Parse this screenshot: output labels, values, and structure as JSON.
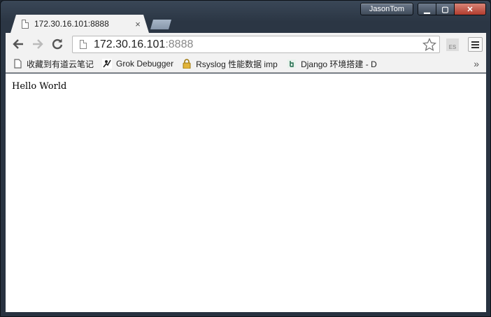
{
  "window": {
    "profile_name": "JasonTom",
    "controls": {
      "minimize": "▁",
      "maximize": "▢",
      "close": "✕"
    }
  },
  "tab": {
    "title": "172.30.16.101:8888",
    "close": "×"
  },
  "omnibox": {
    "host": "172.30.16.101",
    "port": ":8888"
  },
  "extension": {
    "label": "ES"
  },
  "bookmarks": {
    "items": [
      {
        "label": "收藏到有道云笔记",
        "icon": "document-icon"
      },
      {
        "label": "Grok Debugger",
        "icon": "grok-icon"
      },
      {
        "label": "Rsyslog 性能数据 imp",
        "icon": "lock-icon"
      },
      {
        "label": "Django 环境搭建 - D",
        "icon": "django-icon"
      }
    ],
    "more": "»"
  },
  "page": {
    "body_text": "Hello World"
  }
}
